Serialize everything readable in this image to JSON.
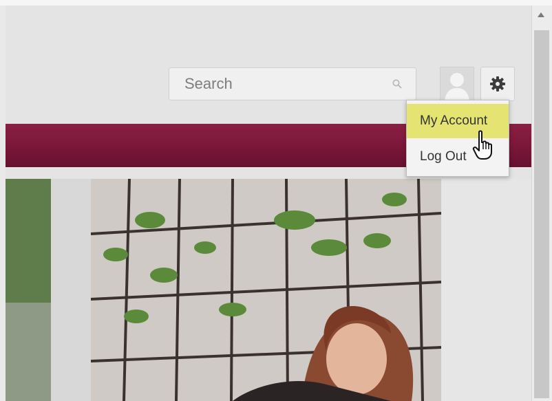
{
  "header": {
    "search": {
      "placeholder": "Search",
      "icon": "search-icon"
    },
    "avatar_icon": "user-avatar-icon",
    "settings_icon": "gear-icon"
  },
  "banner": {
    "color": "#7a1738"
  },
  "account_menu": {
    "items": [
      {
        "label": "My Account",
        "highlighted": true,
        "highlight_color": "#e5e473"
      },
      {
        "label": "Log Out",
        "highlighted": false
      }
    ]
  },
  "pointer": {
    "icon": "hand-pointer-icon"
  }
}
